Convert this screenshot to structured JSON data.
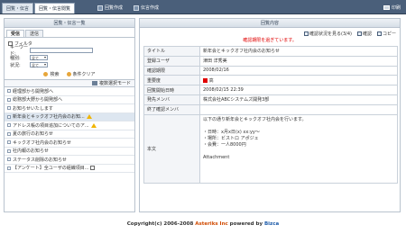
{
  "header": {
    "tabs": [
      "回覧・伝言",
      "回覧・伝言閲覧"
    ],
    "buttons": [
      "回覧作成",
      "伝言作成"
    ],
    "print": "印刷"
  },
  "left": {
    "title": "回覧・伝言一覧",
    "subtabs": [
      "受信",
      "送信"
    ],
    "filter_label": "フィルタ",
    "keyword_label": "キーワード:",
    "keyword_value": "",
    "type_label": "種別:",
    "type_value": "全て",
    "status_label": "状況:",
    "status_value": "全て",
    "search": "検索",
    "clear": "条件クリア",
    "mode": "複数選択モード",
    "items": [
      "経理部から開発部へ",
      "総務部大野から開発部へ",
      "お知らせいたします",
      "新年会とキックオフ社内会のお知...",
      "アドレス帳の項目追加についてのア...",
      "夏の旅行のお知らせ",
      "キックオフ社内会のお知らせ",
      "社内報のお知らせ",
      "ステータス削除のお知らせ",
      "【アンケート】全ユーザの組織項目..."
    ]
  },
  "right": {
    "title": "回覧内容",
    "confirm": "確認状況を見る(3/4)",
    "ok": "確認",
    "copy": "コピー",
    "alert": "確認期限を過ぎています。",
    "fields": [
      {
        "k": "タイトル",
        "v": "新年会とキックオフ社内会のお知らせ"
      },
      {
        "k": "登録ユーザ",
        "v": "津田 洋秀美"
      },
      {
        "k": "確認期限",
        "v": "2008/02/16"
      },
      {
        "k": "重要度",
        "v": "高"
      },
      {
        "k": "回覧開始日時",
        "v": "2008/02/15 22:39"
      },
      {
        "k": "発先メンバ",
        "v": "株式会社ABCシステムズ開発3部"
      },
      {
        "k": "終了確認メンバ",
        "v": ""
      }
    ],
    "body_key": "本文",
    "body": "以下の通り新年会とキックオフ社内会を行います。\n\n・日時：x月x日(x) xx:yy〜\n・場所：ビストロ アポジェ\n・会費：一人8000円\n\nAttachment"
  },
  "footer": {
    "prefix": "Copyright(c) 2006-2008 ",
    "brand": "Asteriks Inc",
    "mid": " powered by ",
    "brand2": "Bizca"
  }
}
